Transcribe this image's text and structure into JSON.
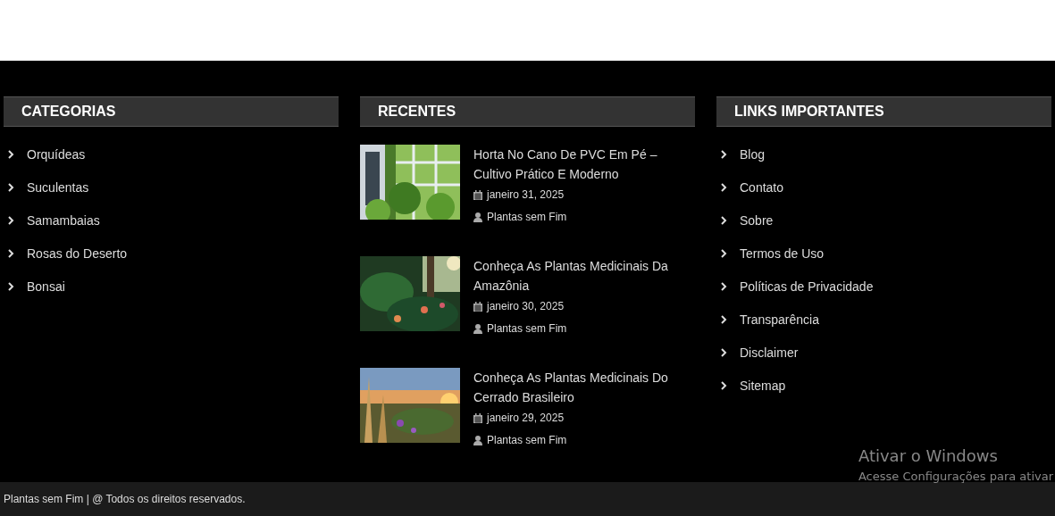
{
  "categories": {
    "title": "CATEGORIAS",
    "items": [
      "Orquídeas",
      "Suculentas",
      "Samambaias",
      "Rosas do Deserto",
      "Bonsai"
    ]
  },
  "recent": {
    "title": "RECENTES",
    "posts": [
      {
        "title": "Horta No Cano De PVC Em Pé – Cultivo Prático E Moderno",
        "date": "janeiro 31, 2025",
        "author": "Plantas sem Fim"
      },
      {
        "title": "Conheça As Plantas Medicinais Da Amazônia",
        "date": "janeiro 30, 2025",
        "author": "Plantas sem Fim"
      },
      {
        "title": "Conheça As Plantas Medicinais Do Cerrado Brasileiro",
        "date": "janeiro 29, 2025",
        "author": "Plantas sem Fim"
      }
    ]
  },
  "links": {
    "title": "LINKS IMPORTANTES",
    "items": [
      "Blog",
      "Contato",
      "Sobre",
      "Termos de Uso",
      "Políticas de Privacidade",
      "Transparência",
      "Disclaimer",
      "Sitemap"
    ]
  },
  "copyright": "Plantas sem Fim | @ Todos os direitos reservados.",
  "os_notice": {
    "title": "Ativar o Windows",
    "text": "Acesse Configurações para ativar"
  }
}
